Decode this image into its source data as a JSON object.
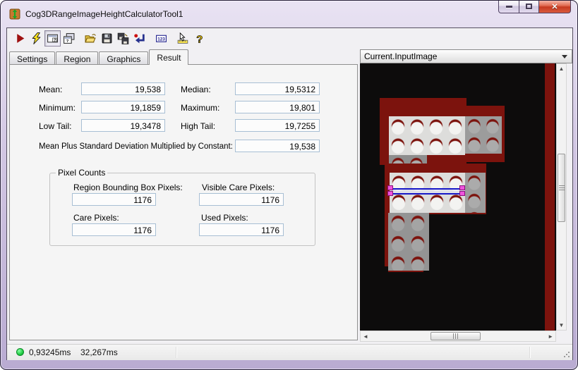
{
  "window": {
    "title": "Cog3DRangeImageHeightCalculatorTool1"
  },
  "toolbar": {
    "icons": [
      "run-icon",
      "electric-run-icon",
      "show-params-window-icon",
      "float-params-window-icon",
      "open-file-icon",
      "save-file-icon",
      "save-all-icon",
      "reset-icon",
      "numeric-results-icon",
      "pointer-measure-icon",
      "help-icon"
    ]
  },
  "tabs": {
    "settings": "Settings",
    "region": "Region",
    "graphics": "Graphics",
    "result": "Result"
  },
  "results": {
    "mean": {
      "label": "Mean:",
      "value": "19,538"
    },
    "median": {
      "label": "Median:",
      "value": "19,5312"
    },
    "minimum": {
      "label": "Minimum:",
      "value": "19,1859"
    },
    "maximum": {
      "label": "Maximum:",
      "value": "19,801"
    },
    "low_tail": {
      "label": "Low Tail:",
      "value": "19,3478"
    },
    "high_tail": {
      "label": "High Tail:",
      "value": "19,7255"
    },
    "mean_plus_sd": {
      "label": "Mean Plus Standard Deviation Multiplied by Constant:",
      "value": "19,538"
    }
  },
  "pixel_counts": {
    "legend": "Pixel Counts",
    "region_bounding": {
      "label": "Region Bounding Box Pixels:",
      "value": "1176"
    },
    "visible_care": {
      "label": "Visible Care Pixels:",
      "value": "1176"
    },
    "care": {
      "label": "Care Pixels:",
      "value": "1176"
    },
    "used": {
      "label": "Used Pixels:",
      "value": "1176"
    }
  },
  "image_panel": {
    "selected_display": "Current.InputImage"
  },
  "status": {
    "time1": "0,93245ms",
    "time2": "32,267ms"
  },
  "colors": {
    "maroon": "#7c130d",
    "caliper_blue": "#1818c8",
    "handle_magenta": "#ee55dd",
    "status_green": "#22cc44",
    "frame_lavender": "#cfc5e2",
    "field_border": "#a8bfd4"
  }
}
